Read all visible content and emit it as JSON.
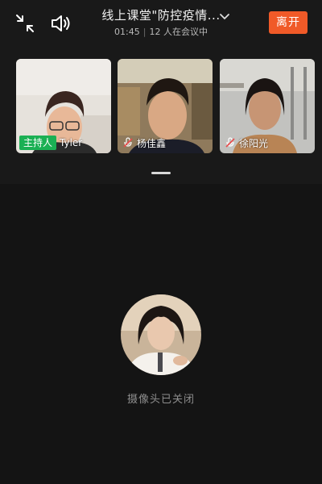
{
  "header": {
    "title": "线上课堂\"防控疫情...",
    "duration": "01:45",
    "attendance": "12 人在会议中",
    "leave_label": "离开"
  },
  "participants": [
    {
      "name": "Tyler",
      "role_badge": "主持人",
      "mic_icon": "mic-muted-icon"
    },
    {
      "name": "杨佳鑫",
      "role_badge": "",
      "mic_icon": "mic-muted-icon"
    },
    {
      "name": "徐阳光",
      "role_badge": "",
      "mic_icon": "mic-muted-icon"
    }
  ],
  "self_view": {
    "status": "摄像头已关闭"
  },
  "colors": {
    "leave_button": "#f05a28",
    "host_badge": "#1bb054",
    "background": "#141414"
  },
  "icons": [
    "minimize-icon",
    "speaker-icon",
    "chevron-down-icon",
    "mic-muted-icon"
  ]
}
